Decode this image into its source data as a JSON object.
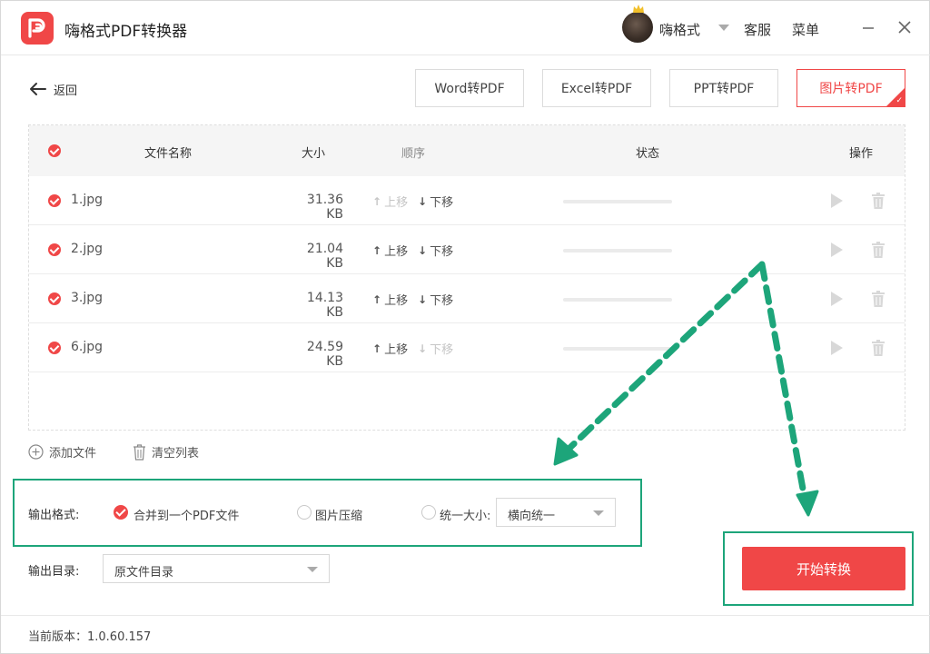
{
  "app": {
    "title": "嗨格式PDF转换器",
    "username": "嗨格式",
    "service_label": "客服",
    "menu_label": "菜单"
  },
  "toolbar": {
    "back_label": "返回",
    "tabs": [
      {
        "label": "Word转PDF",
        "active": false
      },
      {
        "label": "Excel转PDF",
        "active": false
      },
      {
        "label": "PPT转PDF",
        "active": false
      },
      {
        "label": "图片转PDF",
        "active": true
      }
    ]
  },
  "table": {
    "headers": {
      "name": "文件名称",
      "size": "大小",
      "order": "顺序",
      "status": "状态",
      "actions": "操作"
    },
    "move_up_label": "上移",
    "move_down_label": "下移",
    "rows": [
      {
        "name": "1.jpg",
        "size": "31.36 KB",
        "up_enabled": false,
        "down_enabled": true,
        "progress": 0
      },
      {
        "name": "2.jpg",
        "size": "21.04 KB",
        "up_enabled": true,
        "down_enabled": true,
        "progress": 0
      },
      {
        "name": "3.jpg",
        "size": "14.13 KB",
        "up_enabled": true,
        "down_enabled": true,
        "progress": 0
      },
      {
        "name": "6.jpg",
        "size": "24.59 KB",
        "up_enabled": true,
        "down_enabled": false,
        "progress": 0
      }
    ]
  },
  "actions": {
    "add_file_label": "添加文件",
    "clear_list_label": "清空列表"
  },
  "output": {
    "format_label": "输出格式:",
    "options": [
      {
        "label": "合并到一个PDF文件",
        "selected": true
      },
      {
        "label": "图片压缩",
        "selected": false
      },
      {
        "label": "统一大小:",
        "selected": false
      }
    ],
    "size_select_value": "横向统一",
    "dir_label": "输出目录:",
    "dir_select_value": "原文件目录"
  },
  "start_button_label": "开始转换",
  "footer": {
    "version_text": "当前版本：1.0.60.157"
  },
  "colors": {
    "accent": "#f04747",
    "annotation": "#1da57a"
  },
  "icons": {
    "back": "arrow-left-icon",
    "add": "plus-circle-icon",
    "clear": "trash-icon",
    "play": "play-icon",
    "delete": "trash-icon"
  }
}
